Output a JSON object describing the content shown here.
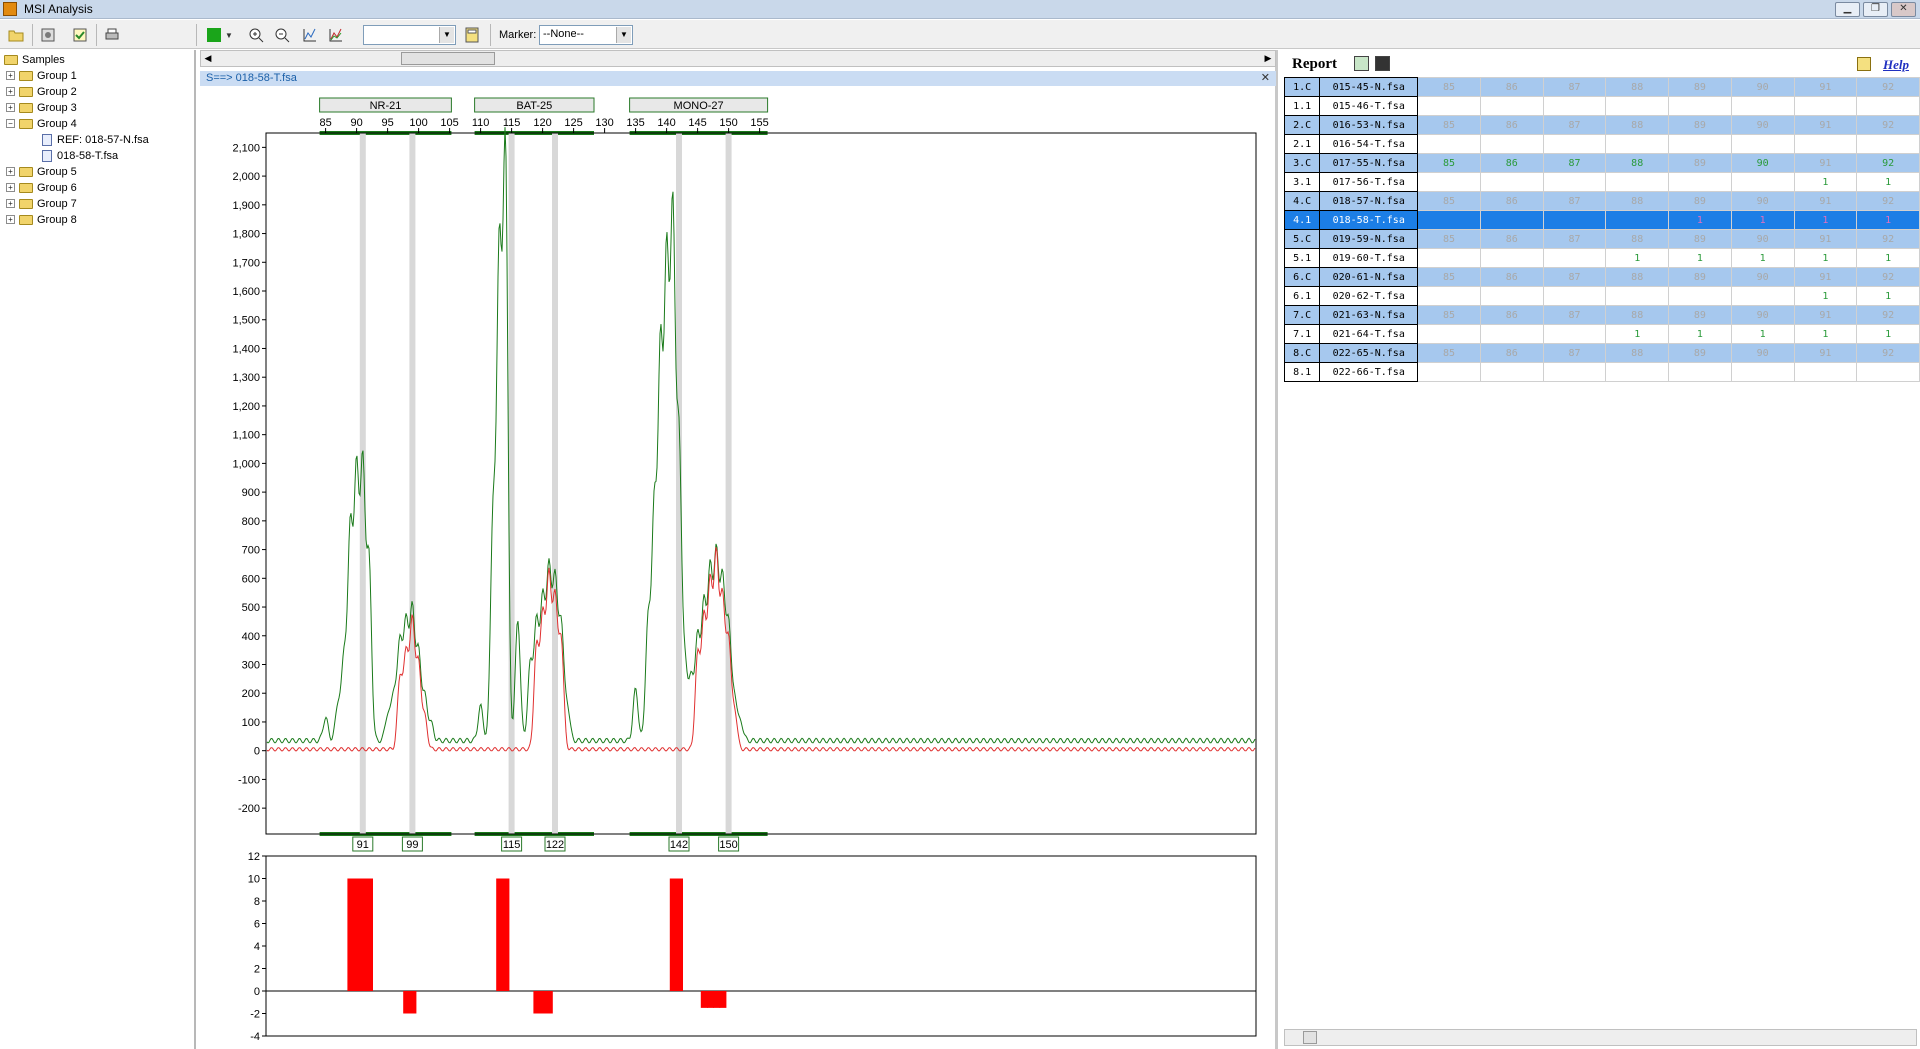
{
  "window": {
    "title": "MSI Analysis"
  },
  "toolbar": {
    "combo_value": "",
    "marker_label": "Marker:",
    "marker_value": "--None--"
  },
  "tree": {
    "root": "Samples",
    "groups": [
      "Group 1",
      "Group 2",
      "Group 3",
      "Group 4",
      "Group 5",
      "Group 6",
      "Group 7",
      "Group 8"
    ],
    "group4_children": [
      "REF: 018-57-N.fsa",
      "018-58-T.fsa"
    ]
  },
  "file_tab": {
    "label": "S==> 018-58-T.fsa"
  },
  "chart_data": [
    {
      "type": "line",
      "markers": [
        {
          "name": "NR-21",
          "range": [
            85,
            104
          ]
        },
        {
          "name": "BAT-25",
          "range": [
            110,
            127
          ]
        },
        {
          "name": "MONO-27",
          "range": [
            135,
            155
          ]
        }
      ],
      "x_ticks": [
        85,
        90,
        95,
        100,
        105,
        110,
        115,
        120,
        125,
        130,
        135,
        140,
        145,
        150,
        155
      ],
      "y_ticks": [
        "2,100",
        "2,000",
        "1,900",
        "1,800",
        "1,700",
        "1,600",
        "1,500",
        "1,400",
        "1,300",
        "1,200",
        "1,100",
        "1,000",
        "900",
        "800",
        "700",
        "600",
        "500",
        "400",
        "300",
        "200",
        "100",
        "0",
        "-100",
        "-200"
      ],
      "ylim": [
        -290,
        2150
      ],
      "highlight_peaks": [
        91,
        99,
        115,
        122,
        142,
        150
      ],
      "series": [
        {
          "color": "#1a7a1a",
          "peaks": [
            [
              85,
              80
            ],
            [
              87,
              130
            ],
            [
              88,
              300
            ],
            [
              89,
              740
            ],
            [
              90,
              920
            ],
            [
              91,
              940
            ],
            [
              92,
              620
            ],
            [
              95,
              90
            ],
            [
              96,
              170
            ],
            [
              97,
              350
            ],
            [
              98,
              410
            ],
            [
              99,
              450
            ],
            [
              100,
              300
            ],
            [
              101,
              150
            ],
            [
              102,
              60
            ],
            [
              110,
              120
            ],
            [
              112,
              780
            ],
            [
              113,
              1680
            ],
            [
              114,
              2060
            ],
            [
              116,
              420
            ],
            [
              118,
              260
            ],
            [
              119,
              400
            ],
            [
              120,
              480
            ],
            [
              121,
              590
            ],
            [
              122,
              560
            ],
            [
              123,
              410
            ],
            [
              124,
              120
            ],
            [
              135,
              180
            ],
            [
              137,
              410
            ],
            [
              138,
              800
            ],
            [
              139,
              1340
            ],
            [
              140,
              1640
            ],
            [
              141,
              1810
            ],
            [
              142,
              1040
            ],
            [
              143,
              260
            ],
            [
              144,
              210
            ],
            [
              145,
              350
            ],
            [
              146,
              460
            ],
            [
              147,
              580
            ],
            [
              148,
              640
            ],
            [
              149,
              560
            ],
            [
              150,
              410
            ],
            [
              151,
              150
            ],
            [
              152,
              60
            ]
          ]
        },
        {
          "color": "#e03030",
          "peaks": [
            [
              97,
              250
            ],
            [
              98,
              330
            ],
            [
              99,
              440
            ],
            [
              100,
              290
            ],
            [
              101,
              110
            ],
            [
              119,
              350
            ],
            [
              120,
              450
            ],
            [
              121,
              590
            ],
            [
              122,
              520
            ],
            [
              123,
              380
            ],
            [
              145,
              320
            ],
            [
              146,
              440
            ],
            [
              147,
              560
            ],
            [
              148,
              660
            ],
            [
              149,
              520
            ],
            [
              150,
              380
            ],
            [
              151,
              130
            ]
          ]
        }
      ]
    },
    {
      "type": "bar",
      "y_ticks": [
        12,
        10,
        8,
        6,
        4,
        2,
        0,
        -2,
        -4
      ],
      "ylim": [
        -4,
        12
      ],
      "x": [
        89,
        90,
        91,
        92,
        98,
        99,
        113,
        114,
        119,
        120,
        121,
        141,
        142,
        146,
        147,
        148,
        149
      ],
      "values": [
        10,
        10,
        10,
        10,
        -2,
        -2,
        10,
        10,
        -2,
        -2,
        -2,
        10,
        10,
        -1.5,
        -1.5,
        -1.5,
        -1.5
      ]
    }
  ],
  "report": {
    "title": "Report",
    "help": "Help",
    "columns": [
      "85",
      "86",
      "87",
      "88",
      "89",
      "90",
      "91",
      "92"
    ],
    "rows": [
      {
        "idx": "1.C",
        "file": "015-45-N.fsa",
        "kind": "ctrl",
        "cells": [
          "85",
          "86",
          "87",
          "88",
          "89",
          "90",
          "91",
          "92"
        ]
      },
      {
        "idx": "1.1",
        "file": "015-46-T.fsa",
        "kind": "tumor",
        "cells": [
          "",
          "",
          "",
          "",
          "",
          "",
          "",
          ""
        ]
      },
      {
        "idx": "2.C",
        "file": "016-53-N.fsa",
        "kind": "ctrl",
        "cells": [
          "85",
          "86",
          "87",
          "88",
          "89",
          "90",
          "91",
          "92"
        ]
      },
      {
        "idx": "2.1",
        "file": "016-54-T.fsa",
        "kind": "tumor",
        "cells": [
          "",
          "",
          "",
          "",
          "",
          "",
          "",
          ""
        ]
      },
      {
        "idx": "3.C",
        "file": "017-55-N.fsa",
        "kind": "ctrl",
        "cells": [
          "85",
          "86",
          "87",
          "88",
          "89",
          "90",
          "91",
          "92"
        ],
        "green": [
          0,
          1,
          2,
          3,
          5,
          7
        ]
      },
      {
        "idx": "3.1",
        "file": "017-56-T.fsa",
        "kind": "tumor",
        "cells": [
          "",
          "",
          "",
          "",
          "",
          "",
          "1",
          "1"
        ],
        "green": [
          6,
          7
        ]
      },
      {
        "idx": "4.C",
        "file": "018-57-N.fsa",
        "kind": "ctrl",
        "cells": [
          "85",
          "86",
          "87",
          "88",
          "89",
          "90",
          "91",
          "92"
        ]
      },
      {
        "idx": "4.1",
        "file": "018-58-T.fsa",
        "kind": "sel",
        "cells": [
          "",
          "",
          "",
          "",
          "1",
          "1",
          "1",
          "1"
        ]
      },
      {
        "idx": "5.C",
        "file": "019-59-N.fsa",
        "kind": "ctrl",
        "cells": [
          "85",
          "86",
          "87",
          "88",
          "89",
          "90",
          "91",
          "92"
        ]
      },
      {
        "idx": "5.1",
        "file": "019-60-T.fsa",
        "kind": "tumor",
        "cells": [
          "",
          "",
          "",
          "1",
          "1",
          "1",
          "1",
          "1"
        ],
        "green": [
          3,
          4,
          5,
          6,
          7
        ]
      },
      {
        "idx": "6.C",
        "file": "020-61-N.fsa",
        "kind": "ctrl",
        "cells": [
          "85",
          "86",
          "87",
          "88",
          "89",
          "90",
          "91",
          "92"
        ]
      },
      {
        "idx": "6.1",
        "file": "020-62-T.fsa",
        "kind": "tumor",
        "cells": [
          "",
          "",
          "",
          "",
          "",
          "",
          "1",
          "1"
        ],
        "green": [
          6,
          7
        ]
      },
      {
        "idx": "7.C",
        "file": "021-63-N.fsa",
        "kind": "ctrl",
        "cells": [
          "85",
          "86",
          "87",
          "88",
          "89",
          "90",
          "91",
          "92"
        ]
      },
      {
        "idx": "7.1",
        "file": "021-64-T.fsa",
        "kind": "tumor",
        "cells": [
          "",
          "",
          "",
          "1",
          "1",
          "1",
          "1",
          "1"
        ],
        "green": [
          3,
          4,
          5,
          6,
          7
        ]
      },
      {
        "idx": "8.C",
        "file": "022-65-N.fsa",
        "kind": "ctrl",
        "cells": [
          "85",
          "86",
          "87",
          "88",
          "89",
          "90",
          "91",
          "92"
        ]
      },
      {
        "idx": "8.1",
        "file": "022-66-T.fsa",
        "kind": "tumor",
        "cells": [
          "",
          "",
          "",
          "",
          "",
          "",
          "",
          ""
        ]
      }
    ]
  },
  "icons": [
    "open-folder-icon",
    "settings-icon",
    "checklist-icon",
    "print-icon",
    "green-square-icon",
    "zoom-in-icon",
    "zoom-out-icon",
    "chart-icon",
    "overlay-icon",
    "calculator-icon",
    "report-export-icon",
    "save-icon",
    "help-icon"
  ]
}
